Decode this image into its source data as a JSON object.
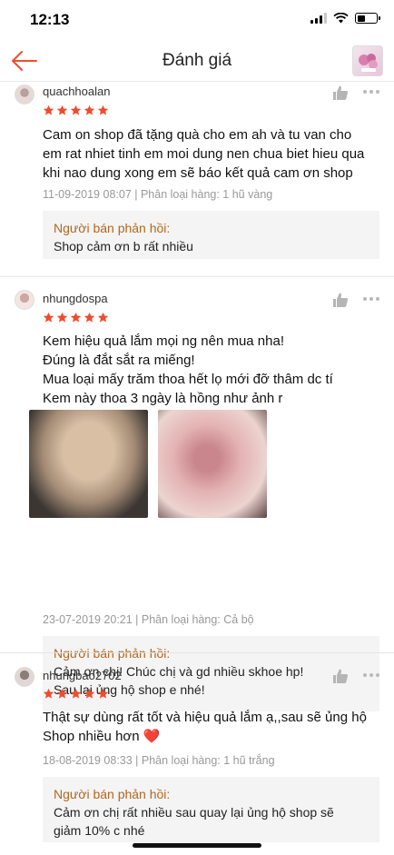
{
  "status_bar": {
    "time": "12:13"
  },
  "header": {
    "title": "Đánh giá"
  },
  "colors": {
    "accent": "#ee4d2d",
    "reply_title": "#b5651d",
    "star": "#ee4d2d"
  },
  "reviews": [
    {
      "username": "quachhoalan",
      "rating": 5,
      "text": "Cam on shop đã tặng quà cho em ah và tu van cho\nem rat nhiet tinh em moi dung nen chua biet hieu qua\nkhi nao dung xong em sẽ báo kết quả cam ơn shop",
      "meta": "11-09-2019 08:07 | Phân loại hàng: 1 hũ vàng",
      "reply_title": "Người bán phản hồi:",
      "reply_text": "Shop cảm ơn b rất nhiều"
    },
    {
      "username": "nhungdospa",
      "rating": 5,
      "text": "Kem hiệu quả lắm mọi ng nên mua nha!\nĐúng là đắt sắt ra miếng!\nMua loại mấy trăm thoa hết lọ mới đỡ thâm dc tí\nKem này thoa 3 ngày là hồng như ảnh r",
      "meta": "23-07-2019 20:21 | Phân loại hàng: Cả bộ",
      "reply_title": "Người bán phản hồi:",
      "reply_text": "Cảm ơn chị! Chúc chị và gd nhiều skhoe hp!\nSau lại ủng hộ shop e nhé!"
    },
    {
      "username": "nhungbao2702",
      "rating": 5,
      "text": "Thật sự dùng rất tốt và hiệu quả lắm ạ,,sau sẽ ủng hộ\nShop nhiều hơn ❤️",
      "meta": "18-08-2019 08:33 | Phân loại hàng: 1 hũ trắng",
      "reply_title": "Người bán phản hồi:",
      "reply_text": "Cảm ơn chị rất nhiều sau quay lại ủng hộ shop sẽ\ngiảm 10% c nhé"
    }
  ]
}
